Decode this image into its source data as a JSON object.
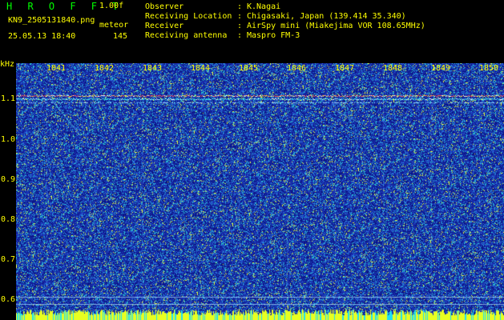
{
  "header": {
    "app_title": "H R O F F T",
    "version": "1.00f",
    "filename": "KN9_2505131840.png",
    "mode": "meteor",
    "datetime": "25.05.13 18:40",
    "count": "145",
    "fields": [
      {
        "label": "Observer",
        "value": "K.Nagai"
      },
      {
        "label": "Receiving Location",
        "value": "Chigasaki, Japan (139.414 35.340)"
      },
      {
        "label": "Receiver",
        "value": "AirSpy mini (Miakejima VOR 108.65MHz)"
      },
      {
        "label": "Receiving antenna",
        "value": "Maspro FM-3"
      }
    ]
  },
  "plot": {
    "y_axis_unit": "kHz",
    "x_tick_labels": [
      "1841",
      "1842",
      "1843",
      "1844",
      "1845",
      "1846",
      "1847",
      "1848",
      "1849",
      "1850"
    ],
    "y_tick_labels": [
      "1.1",
      "1.0",
      "0.9",
      "0.8",
      "0.7",
      "0.6"
    ]
  },
  "colors": {
    "background": "#000000",
    "text": "#ffff00",
    "title_green": "#00ff00",
    "plot_base": "#1a2fb0",
    "noise_cyan": "#2ad0d8",
    "noise_yellow": "#e8ff40",
    "carrier": "#ff4040"
  }
}
